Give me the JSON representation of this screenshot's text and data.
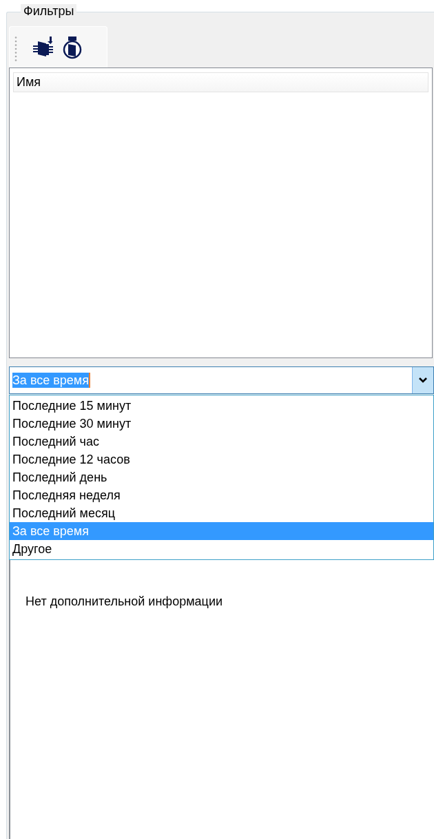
{
  "group": {
    "title": "Фильтры"
  },
  "list": {
    "columns": [
      "Имя"
    ]
  },
  "period_combo": {
    "value": "За все время",
    "expanded": true,
    "options": [
      {
        "label": "Последние 15 минут",
        "selected": false
      },
      {
        "label": "Последние 30 минут",
        "selected": false
      },
      {
        "label": "Последний час",
        "selected": false
      },
      {
        "label": "Последние 12 часов",
        "selected": false
      },
      {
        "label": "Последний день",
        "selected": false
      },
      {
        "label": "Последняя неделя",
        "selected": false
      },
      {
        "label": "Последний месяц",
        "selected": false
      },
      {
        "label": "За все время",
        "selected": true
      },
      {
        "label": "Другое",
        "selected": false
      }
    ]
  },
  "info": {
    "text": "Нет дополнительной информации"
  }
}
